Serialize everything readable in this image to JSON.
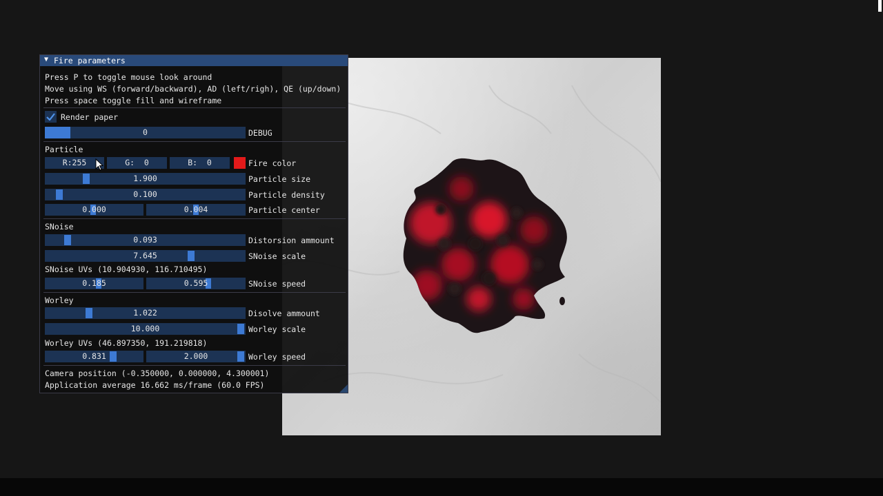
{
  "panel": {
    "title": "Fire parameters",
    "help_lines": [
      "Press P to toggle mouse look around",
      "Move using WS (forward/backward), AD (left/righ), QE (up/down)",
      "Press space toggle fill and wireframe"
    ],
    "render_paper": {
      "label": "Render paper",
      "checked": true
    },
    "debug": {
      "value": "0",
      "label": "DEBUG",
      "fill_fraction": 0.13
    },
    "particle": {
      "header": "Particle",
      "fire_color": {
        "r": "R:255",
        "g": "G:  0",
        "b": "B:  0",
        "label": "Fire color",
        "swatch": "#e31a1a"
      },
      "size": {
        "value": "1.900",
        "label": "Particle size"
      },
      "density": {
        "value": "0.100",
        "label": "Particle density"
      },
      "center": {
        "x": "0.000",
        "y": "0.004",
        "label": "Particle center"
      }
    },
    "snoise": {
      "header": "SNoise",
      "distortion": {
        "value": "0.093",
        "label": "Distorsion ammount"
      },
      "scale": {
        "value": "7.645",
        "label": "SNoise scale"
      },
      "uvs": "SNoise UVs (10.904930, 116.710495)",
      "speed": {
        "x": "0.185",
        "y": "0.595",
        "label": "SNoise speed"
      }
    },
    "worley": {
      "header": "Worley",
      "dissolve": {
        "value": "1.022",
        "label": "Disolve ammount"
      },
      "scale": {
        "value": "10.000",
        "label": "Worley scale"
      },
      "uvs": "Worley UVs (46.897350, 191.219818)",
      "speed": {
        "x": "0.831",
        "y": "2.000",
        "label": "Worley speed"
      }
    },
    "camera_position": "Camera position (-0.350000, 0.000000, 4.300001)",
    "app_average": "Application average 16.662 ms/frame (60.0 FPS)"
  },
  "icons": {
    "collapse": "triangle-down-icon",
    "checkbox": "checkmark-icon",
    "cursor": "mouse-pointer-icon",
    "resize": "resize-grip-icon"
  },
  "colors": {
    "title_bar": "#294a7a",
    "frame_bg": "#1c3354",
    "slider_grab": "#3d7ad4",
    "fire_red": "#e31a1a"
  }
}
